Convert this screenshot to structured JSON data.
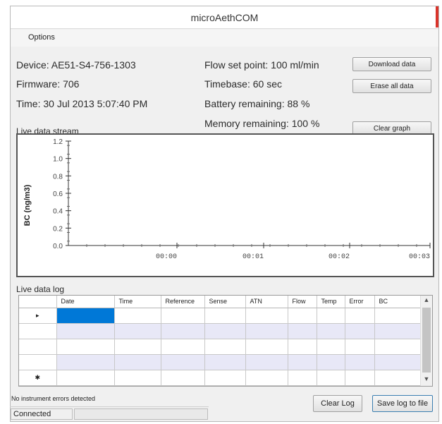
{
  "window": {
    "title": "microAethCOM"
  },
  "menu": {
    "options": "Options"
  },
  "device_info": {
    "device": "Device: AE51-S4-756-1303",
    "firmware": "Firmware: 706",
    "time": "Time: 30 Jul 2013 5:07:40 PM",
    "flow": "Flow set point: 100 ml/min",
    "timebase": "Timebase: 60 sec",
    "battery": "Battery remaining: 88 %",
    "memory": "Memory remaining: 100 %"
  },
  "buttons": {
    "download": "Download data",
    "erase": "Erase all data",
    "clear_graph": "Clear graph",
    "clear_log": "Clear Log",
    "save_log": "Save log to file"
  },
  "graph": {
    "label": "Live data stream"
  },
  "chart_data": {
    "type": "line",
    "ylabel": "BC (ng/m3)",
    "xlabel": "",
    "y_ticks": [
      "0.0",
      "0.2",
      "0.4",
      "0.6",
      "0.8",
      "1.0",
      "1.2"
    ],
    "x_ticks": [
      "00:00",
      "00:01",
      "00:02",
      "00:03"
    ],
    "ylim": [
      0,
      1.2
    ],
    "series": []
  },
  "log": {
    "label": "Live data log",
    "columns": [
      "Date",
      "Time",
      "Reference",
      "Sense",
      "ATN",
      "Flow",
      "Temp",
      "Error",
      "BC"
    ],
    "row_markers": [
      "▸",
      "",
      "",
      "",
      "✱"
    ]
  },
  "status": {
    "message": "No instrument errors detected",
    "connection": "Connected"
  }
}
